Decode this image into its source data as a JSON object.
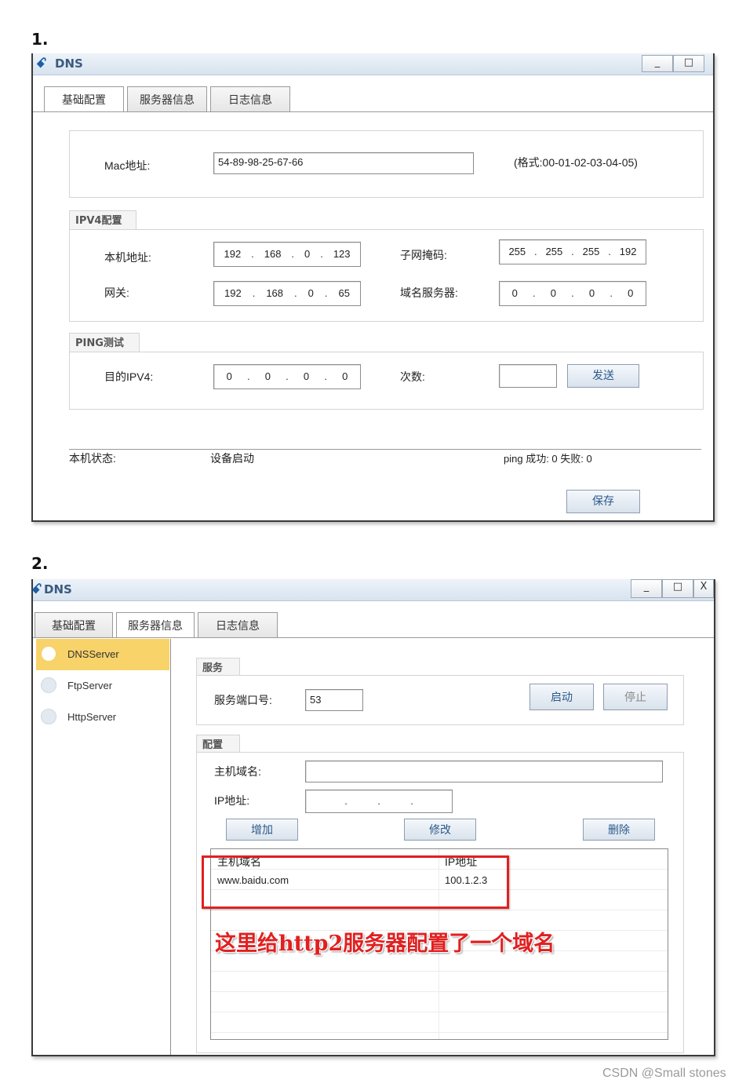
{
  "labels": {
    "step1": "1.",
    "step2": "2."
  },
  "window": {
    "title": "DNS",
    "minimize": "_",
    "maximize": "□",
    "close": "X"
  },
  "tabs": [
    "基础配置",
    "服务器信息",
    "日志信息"
  ],
  "basic": {
    "mac_label": "Mac地址:",
    "mac_value": "54-89-98-25-67-66",
    "mac_hint": "(格式:00-01-02-03-04-05)",
    "ipv4_group": "IPV4配置",
    "local_ip_label": "本机地址:",
    "local_ip": [
      "192",
      "168",
      "0",
      "123"
    ],
    "mask_label": "子网掩码:",
    "mask": [
      "255",
      "255",
      "255",
      "192"
    ],
    "gateway_label": "网关:",
    "gateway": [
      "192",
      "168",
      "0",
      "65"
    ],
    "dns_label": "域名服务器:",
    "dns": [
      "0",
      "0",
      "0",
      "0"
    ],
    "ping_group": "PING测试",
    "target_label": "目的IPV4:",
    "target": [
      "0",
      "0",
      "0",
      "0"
    ],
    "count_label": "次数:",
    "count_value": "",
    "send_button": "发送",
    "status_label": "本机状态:",
    "status_value": "设备启动",
    "ping_result": "ping 成功: 0 失败: 0",
    "save_button": "保存"
  },
  "server": {
    "sidebar": [
      {
        "label": "DNSServer",
        "selected": true
      },
      {
        "label": "FtpServer",
        "selected": false
      },
      {
        "label": "HttpServer",
        "selected": false
      }
    ],
    "service_group": "服务",
    "port_label": "服务端口号:",
    "port_value": "53",
    "start_button": "启动",
    "stop_button": "停止",
    "config_group": "配置",
    "host_label": "主机域名:",
    "host_value": "",
    "ip_label": "IP地址:",
    "add_button": "增加",
    "edit_button": "修改",
    "delete_button": "删除",
    "table": {
      "headers": [
        "主机域名",
        "IP地址"
      ],
      "rows": [
        [
          "www.baidu.com",
          "100.1.2.3"
        ]
      ]
    },
    "annotation": "这里给http2服务器配置了一个域名"
  },
  "watermark": "CSDN @Small stones",
  "colors": {
    "accent": "#2b5a8c",
    "annotation": "#e02020",
    "selected_item": "#f8d36a"
  }
}
